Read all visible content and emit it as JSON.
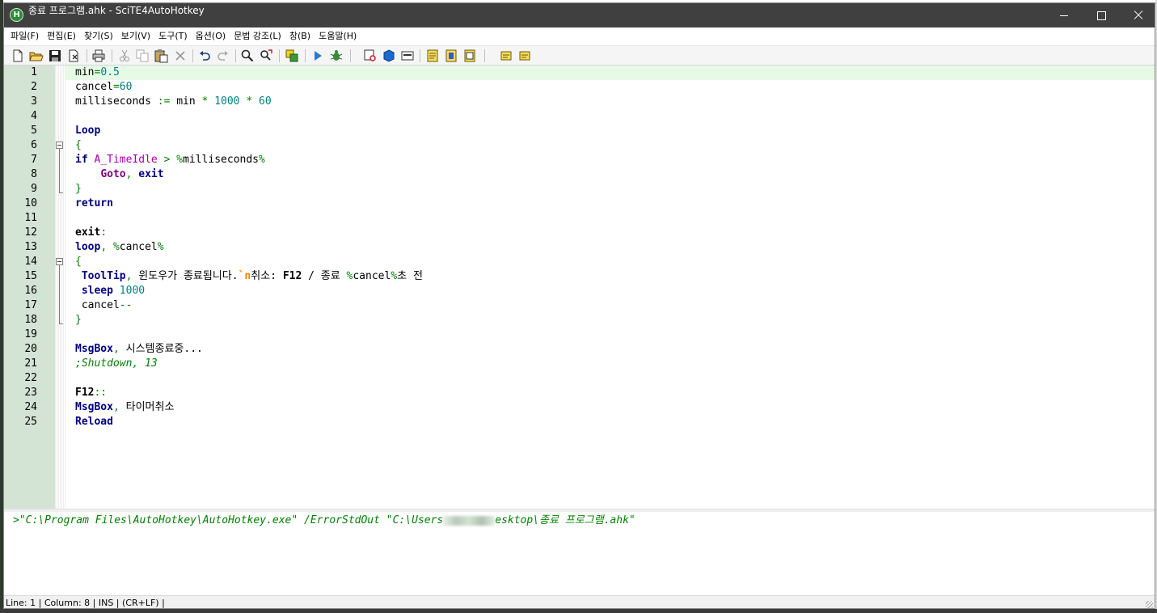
{
  "window": {
    "title": "종료 프로그램.ahk - SciTE4AutoHotkey",
    "app_icon_letter": "H"
  },
  "menu": [
    "파일(F)",
    "편집(E)",
    "찾기(S)",
    "보기(V)",
    "도구(T)",
    "옵션(O)",
    "문법 강조(L)",
    "창(B)",
    "도움말(H)"
  ],
  "toolbar": {
    "icons": [
      "new-file-icon",
      "open-file-icon",
      "save-icon",
      "close-file-icon",
      "print-icon",
      "cut-icon",
      "copy-icon",
      "paste-icon",
      "delete-icon",
      "undo-icon",
      "redo-icon",
      "find-icon",
      "replace-icon",
      "compile-icon",
      "run-icon",
      "debug-icon",
      "window-spy-icon",
      "object-browser-icon",
      "toolbox-icon",
      "script-icon-1",
      "script-icon-2",
      "script-icon-3",
      "script-icon-4",
      "script-icon-5"
    ]
  },
  "editor": {
    "lines": [
      {
        "n": "1",
        "tokens": [
          {
            "t": "min",
            "c": ""
          },
          {
            "t": "=",
            "c": "op"
          },
          {
            "t": "0.5",
            "c": "num"
          }
        ]
      },
      {
        "n": "2",
        "tokens": [
          {
            "t": "cancel",
            "c": ""
          },
          {
            "t": "=",
            "c": "op"
          },
          {
            "t": "60",
            "c": "num"
          }
        ]
      },
      {
        "n": "3",
        "tokens": [
          {
            "t": "milliseconds ",
            "c": ""
          },
          {
            "t": ":=",
            "c": "op"
          },
          {
            "t": " min ",
            "c": ""
          },
          {
            "t": "*",
            "c": "op"
          },
          {
            "t": " ",
            "c": ""
          },
          {
            "t": "1000",
            "c": "num"
          },
          {
            "t": " ",
            "c": ""
          },
          {
            "t": "*",
            "c": "op"
          },
          {
            "t": " ",
            "c": ""
          },
          {
            "t": "60",
            "c": "num"
          }
        ]
      },
      {
        "n": "4",
        "tokens": []
      },
      {
        "n": "5",
        "tokens": [
          {
            "t": "Loop",
            "c": "kw"
          }
        ]
      },
      {
        "n": "6",
        "tokens": [
          {
            "t": "{",
            "c": "op"
          }
        ]
      },
      {
        "n": "7",
        "tokens": [
          {
            "t": "if",
            "c": "kw"
          },
          {
            "t": " ",
            "c": ""
          },
          {
            "t": "A_TimeIdle",
            "c": "var"
          },
          {
            "t": " ",
            "c": ""
          },
          {
            "t": ">",
            "c": "op"
          },
          {
            "t": " ",
            "c": ""
          },
          {
            "t": "%",
            "c": "op"
          },
          {
            "t": "milliseconds",
            "c": ""
          },
          {
            "t": "%",
            "c": "op"
          }
        ]
      },
      {
        "n": "8",
        "tokens": [
          {
            "t": "    ",
            "c": ""
          },
          {
            "t": "Goto",
            "c": "var2"
          },
          {
            "t": ",",
            "c": "op"
          },
          {
            "t": " ",
            "c": ""
          },
          {
            "t": "exit",
            "c": "kw"
          }
        ]
      },
      {
        "n": "9",
        "tokens": [
          {
            "t": "}",
            "c": "op"
          }
        ]
      },
      {
        "n": "10",
        "tokens": [
          {
            "t": "return",
            "c": "kw"
          }
        ]
      },
      {
        "n": "11",
        "tokens": []
      },
      {
        "n": "12",
        "tokens": [
          {
            "t": "exit",
            "c": "key2"
          },
          {
            "t": ":",
            "c": "op"
          }
        ]
      },
      {
        "n": "13",
        "tokens": [
          {
            "t": "loop",
            "c": "kw"
          },
          {
            "t": ",",
            "c": "op"
          },
          {
            "t": " ",
            "c": ""
          },
          {
            "t": "%",
            "c": "op"
          },
          {
            "t": "cancel",
            "c": ""
          },
          {
            "t": "%",
            "c": "op"
          }
        ]
      },
      {
        "n": "14",
        "tokens": [
          {
            "t": "{",
            "c": "op"
          }
        ]
      },
      {
        "n": "15",
        "tokens": [
          {
            "t": " ",
            "c": ""
          },
          {
            "t": "ToolTip",
            "c": "cmd"
          },
          {
            "t": ",",
            "c": "op"
          },
          {
            "t": " 윈도우가 종료됩니다.",
            "c": ""
          },
          {
            "t": "`n",
            "c": "esc"
          },
          {
            "t": "취소: ",
            "c": ""
          },
          {
            "t": "F12",
            "c": "key2"
          },
          {
            "t": " / 종료 ",
            "c": ""
          },
          {
            "t": "%",
            "c": "op"
          },
          {
            "t": "cancel",
            "c": ""
          },
          {
            "t": "%",
            "c": "op"
          },
          {
            "t": "초 전",
            "c": ""
          }
        ]
      },
      {
        "n": "16",
        "tokens": [
          {
            "t": " ",
            "c": ""
          },
          {
            "t": "sleep",
            "c": "cmd"
          },
          {
            "t": " ",
            "c": ""
          },
          {
            "t": "1000",
            "c": "num"
          }
        ]
      },
      {
        "n": "17",
        "tokens": [
          {
            "t": " cancel",
            "c": ""
          },
          {
            "t": "--",
            "c": "op"
          }
        ]
      },
      {
        "n": "18",
        "tokens": [
          {
            "t": "}",
            "c": "op"
          }
        ]
      },
      {
        "n": "19",
        "tokens": []
      },
      {
        "n": "20",
        "tokens": [
          {
            "t": "MsgBox",
            "c": "cmd"
          },
          {
            "t": ",",
            "c": "op"
          },
          {
            "t": " 시스템종료중...",
            "c": ""
          }
        ]
      },
      {
        "n": "21",
        "tokens": [
          {
            "t": ";Shutdown, 13",
            "c": "cmt"
          }
        ]
      },
      {
        "n": "22",
        "tokens": []
      },
      {
        "n": "23",
        "tokens": [
          {
            "t": "F12",
            "c": "key2"
          },
          {
            "t": "::",
            "c": "op"
          }
        ]
      },
      {
        "n": "24",
        "tokens": [
          {
            "t": "MsgBox",
            "c": "cmd"
          },
          {
            "t": ",",
            "c": "op"
          },
          {
            "t": " 타이머취소",
            "c": ""
          }
        ]
      },
      {
        "n": "25",
        "tokens": [
          {
            "t": "Reload",
            "c": "kw"
          }
        ]
      }
    ]
  },
  "output": {
    "prefix": ">\"C:\\Program Files\\AutoHotkey\\AutoHotkey.exe\" /ErrorStdOut \"C:\\Users",
    "suffix": "esktop\\종료 프로그램.ahk\""
  },
  "status": {
    "text": "Line: 1 | Column: 8 | INS | (CR+LF) |"
  },
  "colors": {
    "titlebar": "#404040",
    "margin": "#d4e4d4",
    "current_line": "#e6fae6",
    "keyword": "#00007f",
    "variable": "#aa00aa",
    "number": "#007f7f",
    "operator": "#007f00",
    "comment": "#007f00"
  }
}
